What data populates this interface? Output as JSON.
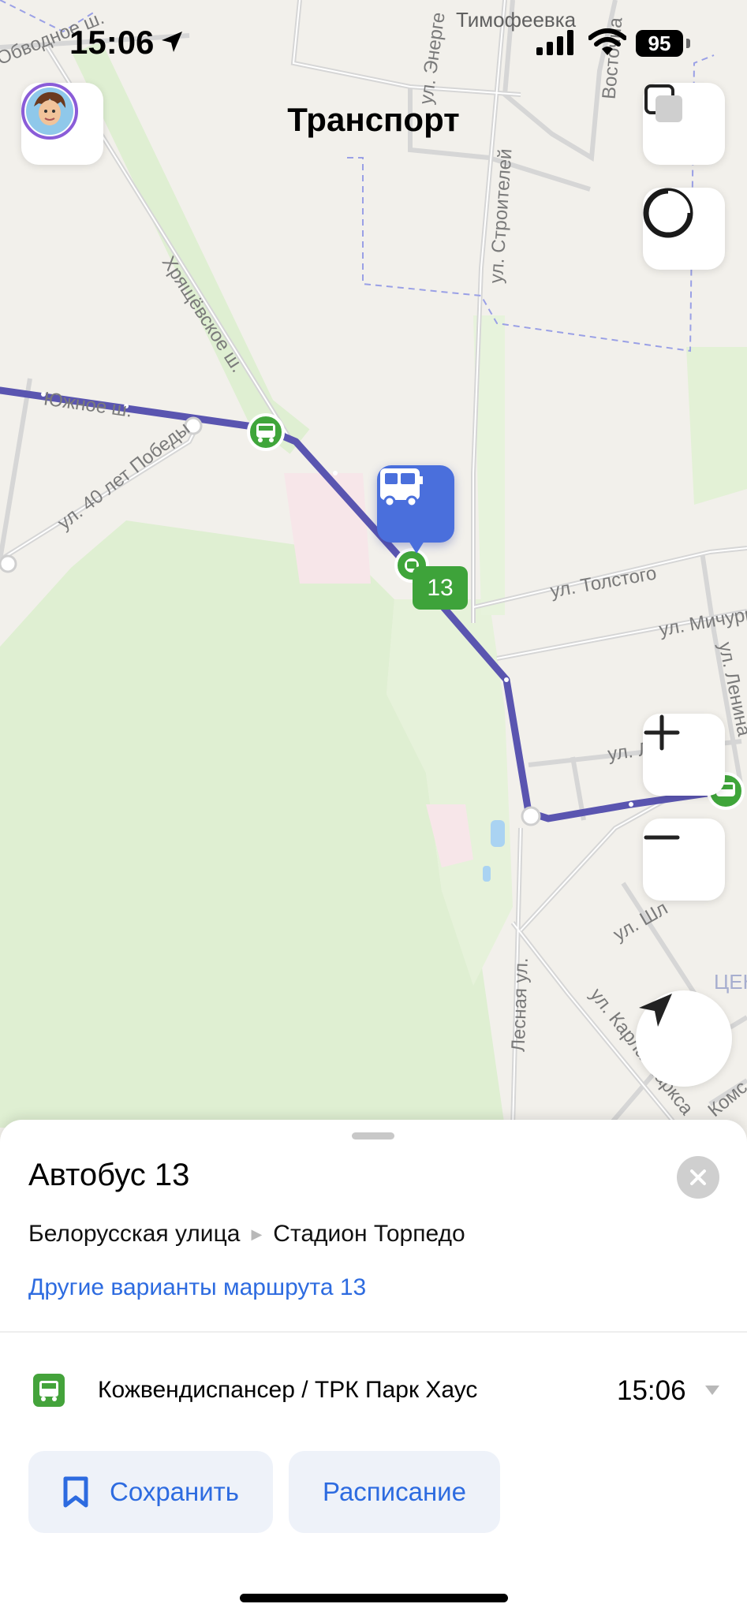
{
  "status_bar": {
    "time": "15:06",
    "battery": "95"
  },
  "header": {
    "title": "Транспорт"
  },
  "map": {
    "labels": {
      "village": "Тимофеевка",
      "street_hryashchevskoe": "Хрящёвское ш.",
      "street_yuzhnoe": "Южное ш.",
      "street_40_let_pobedy": "ул. 40 лет Победы",
      "street_stroiteley": "ул. Строителей",
      "street_tolstogo": "ул. Толстого",
      "street_michurina": "ул. Мичури",
      "street_lenina": "ул. Ленина",
      "street_lesnaya": "Лесная ул.",
      "street_karla_marksa": "ул. Карла Маркса",
      "street_shl": "ул. Шл",
      "street_energ": "ул. Энерге",
      "street_vost": "Восточна",
      "street_obvodnoe": "Обводное ш.",
      "district_cen": "ЦЕН",
      "street_kom": "Комс",
      "street_larina": "ул. Ларина"
    },
    "route_badge": "13",
    "route_color": "#5a55b0"
  },
  "sheet": {
    "title": "Автобус 13",
    "route_from": "Белорусская улица",
    "route_to": "Стадион Торпедо",
    "other_variants": "Другие варианты маршрута 13",
    "stop": {
      "name": "Кожвендиспансер / ТРК Парк Хаус",
      "time": "15:06"
    },
    "save_label": "Сохранить",
    "schedule_label": "Расписание"
  }
}
